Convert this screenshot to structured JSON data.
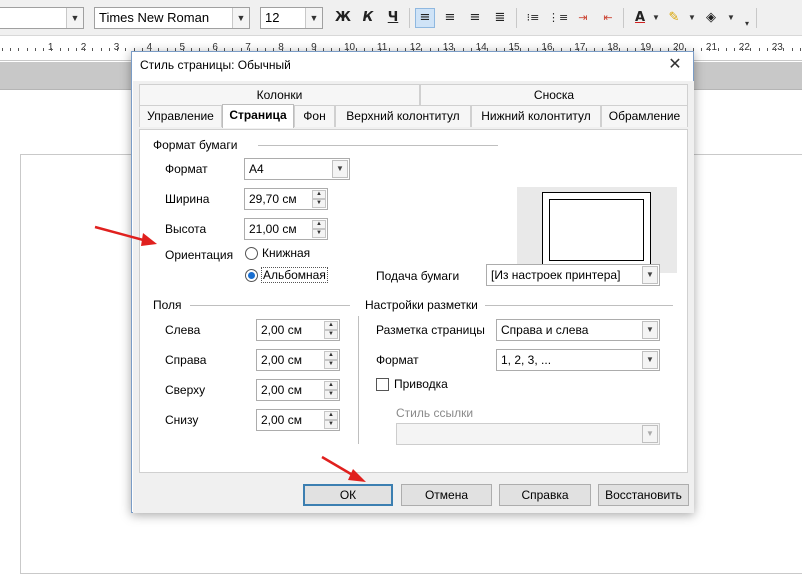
{
  "toolbar": {
    "style_value": "",
    "font_name": "Times New Roman",
    "font_size": "12",
    "bold_label": "Ж",
    "italic_label": "К",
    "underline_label": "Ч"
  },
  "ruler": {
    "numbers": [
      "1",
      "2",
      "3",
      "4",
      "5",
      "6",
      "7",
      "8",
      "9",
      "10",
      "11",
      "12",
      "13",
      "14",
      "15",
      "16",
      "17",
      "18",
      "19",
      "20",
      "21",
      "22",
      "23"
    ]
  },
  "dialog": {
    "title": "Стиль страницы: Обычный",
    "tabs_top": [
      "Колонки",
      "Сноска"
    ],
    "tabs_bottom": [
      "Управление",
      "Страница",
      "Фон",
      "Верхний колонтитул",
      "Нижний колонтитул",
      "Обрамление"
    ],
    "selected_tab": "Страница",
    "paper_format": {
      "section": "Формат бумаги",
      "format_label": "Формат",
      "format_value": "A4",
      "width_label": "Ширина",
      "width_value": "29,70 см",
      "height_label": "Высота",
      "height_value": "21,00 см",
      "orientation_label": "Ориентация",
      "portrait_label": "Книжная",
      "landscape_label": "Альбомная",
      "orientation_selected": "Альбомная",
      "tray_label": "Подача бумаги",
      "tray_value": "[Из настроек принтера]"
    },
    "margins": {
      "section": "Поля",
      "left_label": "Слева",
      "left_value": "2,00 см",
      "right_label": "Справа",
      "right_value": "2,00 см",
      "top_label": "Сверху",
      "top_value": "2,00 см",
      "bottom_label": "Снизу",
      "bottom_value": "2,00 см"
    },
    "layout": {
      "section": "Настройки разметки",
      "page_layout_label": "Разметка страницы",
      "page_layout_value": "Справа и слева",
      "format_label": "Формат",
      "format_value": "1, 2, 3, ...",
      "register_label": "Приводка",
      "register_checked": false,
      "ref_style_label": "Стиль ссылки",
      "ref_style_value": ""
    },
    "buttons": {
      "ok": "ОК",
      "cancel": "Отмена",
      "help": "Справка",
      "reset": "Восстановить"
    }
  },
  "colors": {
    "arrow": "#e0201e",
    "accent": "#1a6fd0"
  }
}
